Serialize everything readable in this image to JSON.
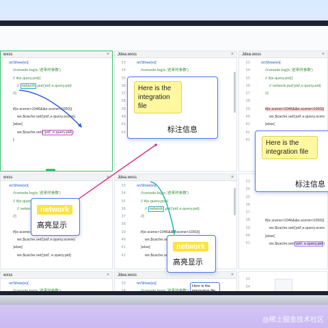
{
  "tabs": {
    "tl": "wxss",
    "tm": "Jdea.wxss",
    "tr": "Jdea.wxss",
    "ml": "wxss",
    "mm": "Jdea.wxss",
    "bl": "wxss",
    "bm": "Jdea.wxss"
  },
  "close_glyph": "×",
  "line_numbers": {
    "tm": [
      "33",
      "34",
      "35",
      "36",
      "37",
      "38",
      "39",
      "40",
      "41",
      "42"
    ],
    "tr": [
      "33",
      "34",
      "35",
      "36",
      "37",
      "38",
      "39",
      "40",
      "41",
      "42",
      "43"
    ],
    "mm": [
      "33",
      "34",
      "35",
      "36",
      "37",
      "38",
      "39",
      "40",
      "41",
      "42"
    ],
    "mr": [
      "33",
      "34",
      "35",
      "36",
      "37",
      "38",
      "39",
      "40",
      "41"
    ],
    "bm": [
      "33",
      "34",
      "35",
      "36"
    ],
    "br": [
      "33",
      "34",
      "35"
    ]
  },
  "code": {
    "onshow": "onShow(e){",
    "log": "//console.log(e,'进来时参数')",
    "ifquery": "// if(e.query.pid){",
    "netput_pre": "//",
    "network": "network",
    "netput_post": ".put('pid',e.query.pid)",
    "close": "//}",
    "ifscene": "if(e.scene>1046&&e.scene<1050){",
    "setscene": "wx.$cache.set('pid',e.query.scene)",
    "close2": "}else{",
    "set_pre": "wx.$cache.set(",
    "set_pid": "'pid', e.query.pid",
    "set_post": ")",
    "brace": "}"
  },
  "callouts": {
    "integration_1": "Here is the integration file",
    "caption_1": "标注信息",
    "integration_2": "Here is the integration file",
    "caption_2": "标注信息",
    "network_chip_1": "network",
    "highlight_1": "高亮显示",
    "network_chip_2": "network",
    "highlight_2": "高亮显示",
    "mini_note": "Here is the integration file"
  },
  "watermark": "@稀土掘金技术社区",
  "colors": {
    "accent_blue": "#4a78e8",
    "active_border": "#35c26a",
    "highlight_yellow": "#ffe33a",
    "arrow_magenta": "#e0287a",
    "arrow_teal": "#1fb3a5",
    "arrow_blue": "#2f5be0"
  }
}
